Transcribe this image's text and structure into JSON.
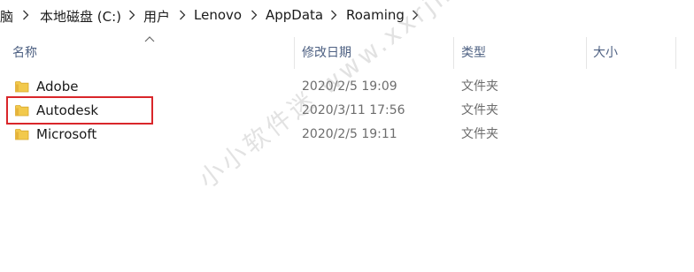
{
  "breadcrumb": {
    "items": [
      {
        "label": "电脑"
      },
      {
        "label": "本地磁盘 (C:)"
      },
      {
        "label": "用户"
      },
      {
        "label": "Lenovo"
      },
      {
        "label": "AppData"
      },
      {
        "label": "Roaming"
      }
    ]
  },
  "columns": {
    "name": "名称",
    "date": "修改日期",
    "type": "类型",
    "size": "大小"
  },
  "files": [
    {
      "name": "Adobe",
      "date": "2020/2/5 19:09",
      "type": "文件夹",
      "icon": "folder-icon"
    },
    {
      "name": "Autodesk",
      "date": "2020/3/11 17:56",
      "type": "文件夹",
      "icon": "folder-icon",
      "highlighted": true
    },
    {
      "name": "Microsoft",
      "date": "2020/2/5 19:11",
      "type": "文件夹",
      "icon": "folder-icon"
    }
  ],
  "watermark": "小小软件迷 www.xxrjm.com",
  "colors": {
    "header_text": "#4d6082",
    "highlight_border": "#d9262a",
    "folder_yellow": "#f2c94c"
  }
}
